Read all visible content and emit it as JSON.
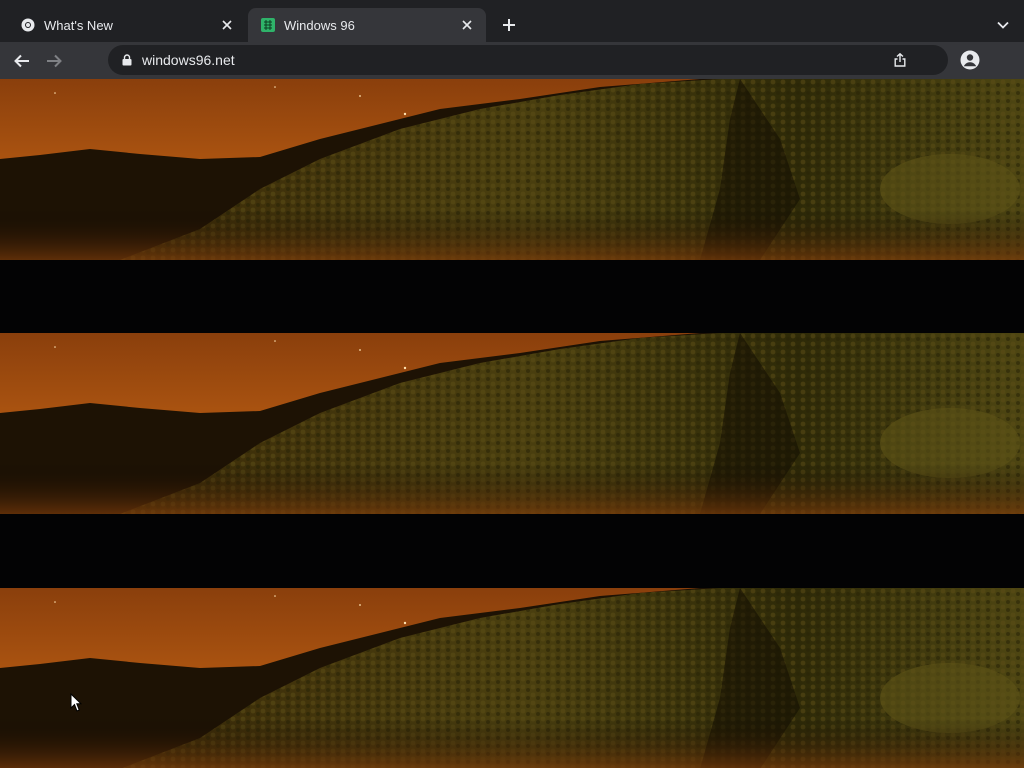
{
  "browser": {
    "tabs": [
      {
        "title": "What's New",
        "icon": "chrome-icon",
        "active": false
      },
      {
        "title": "Windows 96",
        "icon": "windows96-icon",
        "active": true
      }
    ],
    "address": {
      "url": "windows96.net",
      "secure": true
    }
  },
  "colors": {
    "tabstrip_bg": "#202124",
    "toolbar_bg": "#35363a",
    "omnibox_bg": "#202124",
    "text": "#e8eaed",
    "page_bg": "#030304",
    "sky_orange": "#b55a12",
    "hill_olive": "#4a3f0f"
  },
  "page": {
    "wallpaper": {
      "description_icon": "night-hill-wallpaper",
      "repeat_count": 3
    }
  }
}
